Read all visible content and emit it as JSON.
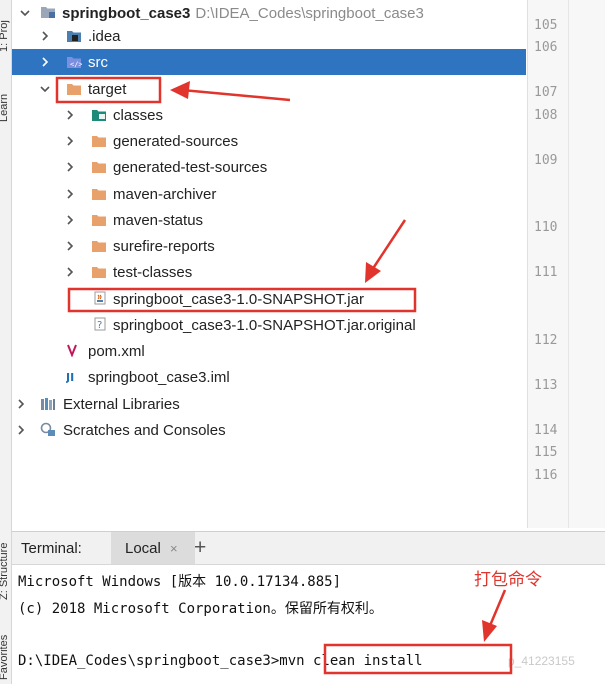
{
  "side_tabs": {
    "project": "1: Proj",
    "learn": "Learn",
    "structure": "Z: Structure",
    "favorites": "Favorites"
  },
  "tree": {
    "project": {
      "name": "springboot_case3",
      "path": "D:\\IDEA_Codes\\springboot_case3"
    },
    "items": [
      {
        "label": ".idea"
      },
      {
        "label": "src"
      },
      {
        "label": "target"
      },
      {
        "label": "classes"
      },
      {
        "label": "generated-sources"
      },
      {
        "label": "generated-test-sources"
      },
      {
        "label": "maven-archiver"
      },
      {
        "label": "maven-status"
      },
      {
        "label": "surefire-reports"
      },
      {
        "label": "test-classes"
      },
      {
        "label": "springboot_case3-1.0-SNAPSHOT.jar"
      },
      {
        "label": "springboot_case3-1.0-SNAPSHOT.jar.original"
      },
      {
        "label": "pom.xml"
      },
      {
        "label": "springboot_case3.iml"
      },
      {
        "label": "External Libraries"
      },
      {
        "label": "Scratches and Consoles"
      }
    ]
  },
  "gutter_lines": [
    "105",
    "106",
    "107",
    "108",
    "109",
    "110",
    "111",
    "112",
    "113",
    "114",
    "115",
    "116"
  ],
  "terminal": {
    "title": "Terminal:",
    "tab": "Local",
    "close": "×",
    "add": "+",
    "lines": [
      "Microsoft Windows [版本 10.0.17134.885]",
      "(c) 2018 Microsoft Corporation。保留所有权利。",
      "",
      "D:\\IDEA_Codes\\springboot_case3>"
    ],
    "command": "mvn clean install"
  },
  "annotation": {
    "text": "打包命令"
  },
  "watermark": "p_41223155",
  "colors": {
    "selection": "#2f74c0",
    "folder": "#e8a16b",
    "annotation": "#e0342c"
  }
}
